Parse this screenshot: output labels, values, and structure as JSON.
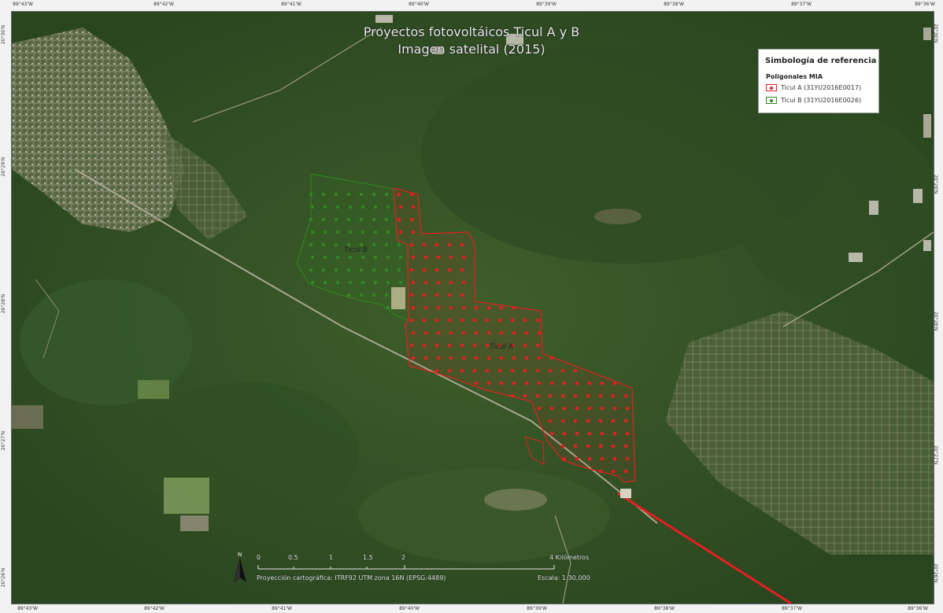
{
  "title": {
    "line1": "Proyectos fotovoltáicos Ticul A y B",
    "line2": "Imagen satelital (2015)"
  },
  "graticule": {
    "top": [
      "89°43'W",
      "89°42'W",
      "89°41'W",
      "89°40'W",
      "89°39'W",
      "89°38'W",
      "89°37'W",
      "89°36'W"
    ],
    "bottom": [
      "89°43'W",
      "89°42'W",
      "89°41'W",
      "89°40'W",
      "89°39'W",
      "89°38'W",
      "89°37'W",
      "89°36'W"
    ],
    "left": [
      "20°30'N",
      "20°29'N",
      "20°28'N",
      "20°27'N",
      "20°26'N"
    ],
    "right": [
      "20°30'N",
      "20°29'N",
      "20°28'N",
      "20°27'N",
      "20°26'N"
    ]
  },
  "legend": {
    "title": "Simbología de referencia",
    "subtitle": "Poligonales MIA",
    "items": [
      {
        "label": "Ticul A (31YU2016E0017)",
        "color": "#e32020"
      },
      {
        "label": "Ticul B (31YU2016E0026)",
        "color": "#2f8a1f"
      }
    ]
  },
  "polygon_labels": {
    "a": "Ticul A",
    "b": "Ticul B"
  },
  "scale_bar": {
    "ticks": [
      "0",
      "0.5",
      "1",
      "1.5",
      "2"
    ],
    "end_label": "4 Kilómetros",
    "projection": "Proyección cartográfica: ITRF92 UTM zona 16N (EPSG:4489)",
    "scale": "Escala: 1:30,000"
  },
  "north_arrow": "N",
  "colors": {
    "forest_dark": "#2c4a1e",
    "forest_mid": "#3a5a27",
    "town": "#8a8770",
    "polygon_a": "#e32020",
    "polygon_b": "#2f8a1f"
  }
}
